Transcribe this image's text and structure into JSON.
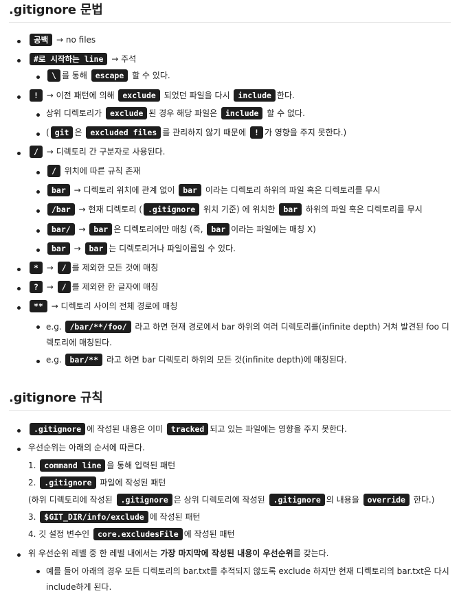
{
  "section1": {
    "heading": ".gitignore 문법",
    "blank": {
      "code": "공백",
      "text": "→ no files"
    },
    "hash": {
      "code": "#로 시작하는 line",
      "text": "→ 주석",
      "sub": {
        "code1": "\\",
        "text1": "를 통해",
        "code2": "escape",
        "text2": "할 수 있다."
      }
    },
    "bang": {
      "code1": "!",
      "text1": "→ 이전 패턴에 의해",
      "code2": "exclude",
      "text2": "되었던 파일을 다시",
      "code3": "include",
      "text3": "한다.",
      "sub1": {
        "text1": "상위 디렉토리가",
        "code1": "exclude",
        "text2": "된 경우 해당 파일은",
        "code2": "include",
        "text3": "할 수 없다."
      },
      "sub2": {
        "text0": "(",
        "code1": "git",
        "text1": "은",
        "code2": "excluded files",
        "text2": "를 관리하지 않기 때문에",
        "code3": "!",
        "text3": "가 영향을 주지 못한다.)"
      }
    },
    "slash": {
      "code": "/",
      "text": "→ 디렉토리 간 구분자로 사용된다.",
      "sub1": {
        "code": "/",
        "text": "위치에 따른 규칙 존재"
      },
      "sub2": {
        "code1": "bar",
        "text1": "→ 디렉토리 위치에 관계 없이",
        "code2": "bar",
        "text2": "이라는 디렉토리 하위의 파일 혹은 디렉토리를 무시"
      },
      "sub3": {
        "code1": "/bar",
        "text1": "→ 현재 디렉토리 (",
        "code2": ".gitignore",
        "text2": "위치 기준) 에 위치한",
        "code3": "bar",
        "text3": "하위의 파일 혹은 디렉토리를 무시"
      },
      "sub4": {
        "code1": "bar/",
        "text1": "→",
        "code2": "bar",
        "text2": "은 디렉토리에만 매칭 (즉,",
        "code3": "bar",
        "text3": "이라는 파일에는 매칭 X)"
      },
      "sub5": {
        "code1": "bar",
        "text1": "→",
        "code2": "bar",
        "text2": "는 디렉토리거나 파일이름일 수 있다."
      }
    },
    "star": {
      "code1": "*",
      "text1": "→",
      "code2": "/",
      "text2": "를 제외한 모든 것에 매칭"
    },
    "question": {
      "code1": "?",
      "text1": "→",
      "code2": "/",
      "text2": "를 제외한 한 글자에 매칭"
    },
    "dstar": {
      "code": "**",
      "text": "→ 디렉토리 사이의 전체 경로에 매칭",
      "sub1": {
        "text1": "e.g.",
        "code": "/bar/**/foo/",
        "text2": "라고 하면 현재 경로에서 bar 하위의 여러 디렉토리를(infinite depth) 거쳐 발견된 foo 디렉토리에 매칭된다."
      },
      "sub2": {
        "text1": "e.g.",
        "code": "bar/**",
        "text2": "라고 하면 bar 디렉토리 하위의 모든 것(infinite depth)에 매칭된다."
      }
    }
  },
  "section2": {
    "heading": ".gitignore 규칙",
    "tracked": {
      "code1": ".gitignore",
      "text1": "에 작성된 내용은 이미",
      "code2": "tracked",
      "text2": "되고 있는 파일에는 영향을 주지 못한다."
    },
    "priority": {
      "text": "우선순위는 아래의 순서에 따른다.",
      "i1": {
        "num": "1.",
        "code": "command line",
        "text": "을 통해 입력된 패턴"
      },
      "i2": {
        "num": "2.",
        "code": ".gitignore",
        "text": "파일에 작성된 패턴",
        "note": {
          "text0": "(하위 디렉토리에 작성된",
          "code1": ".gitignore",
          "text1": "은 상위 디렉토리에 작성된",
          "code2": ".gitignore",
          "text2": "의 내용을",
          "code3": "override",
          "text3": "한다.)"
        }
      },
      "i3": {
        "num": "3.",
        "code": "$GIT_DIR/info/exclude",
        "text": "에 작성된 패턴"
      },
      "i4": {
        "num": "4.",
        "text1": "깃 설정 변수인",
        "code": "core.excludesFile",
        "text2": "에 작성된 패턴"
      }
    },
    "last": {
      "text1": "위 우선순위 레벨 중 한 레벨 내에서는",
      "bold": "가장 마지막에 작성된 내용이 우선순위",
      "text2": "를 갖는다.",
      "sub": "예를 들어 아래의 경우 모든 디렉토리의 bar.txt를 추적되지 않도록 exclude 하지만 현재 디렉토리의 bar.txt은 다시 include하게 된다."
    }
  }
}
